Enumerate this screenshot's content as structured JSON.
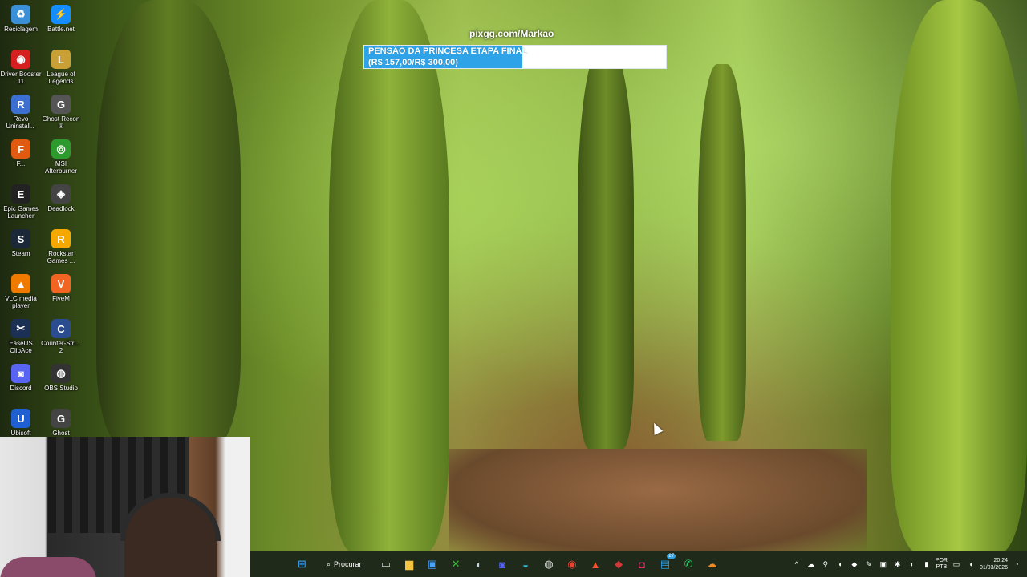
{
  "desktop": {
    "icons": [
      {
        "label": "Reciclagem",
        "icon": "recycle-bin-icon",
        "color": "#3a8fd6",
        "glyph": "♻"
      },
      {
        "label": "Battle.net",
        "icon": "battlenet-icon",
        "color": "#148eff",
        "glyph": "⚡"
      },
      {
        "label": "Driver Booster 11",
        "icon": "driver-booster-icon",
        "color": "#d62020",
        "glyph": "◉"
      },
      {
        "label": "League of Legends",
        "icon": "league-of-legends-icon",
        "color": "#c8a035",
        "glyph": "L"
      },
      {
        "label": "Revo Uninstall...",
        "icon": "revo-uninstaller-icon",
        "color": "#3b6fd0",
        "glyph": "R"
      },
      {
        "label": "Ghost Recon ®",
        "icon": "ghost-recon-icon",
        "color": "#555555",
        "glyph": "G"
      },
      {
        "label": "F...",
        "icon": "orange-app-icon",
        "color": "#e05a10",
        "glyph": "F"
      },
      {
        "label": "MSI Afterburner",
        "icon": "msi-afterburner-icon",
        "color": "#2c9a2c",
        "glyph": "◎"
      },
      {
        "label": "Epic Games Launcher",
        "icon": "epic-games-icon",
        "color": "#222222",
        "glyph": "E"
      },
      {
        "label": "Deadlock",
        "icon": "deadlock-icon",
        "color": "#444444",
        "glyph": "◈"
      },
      {
        "label": "Steam",
        "icon": "steam-icon",
        "color": "#1b2838",
        "glyph": "S"
      },
      {
        "label": "Rockstar Games ...",
        "icon": "rockstar-icon",
        "color": "#f5a800",
        "glyph": "R"
      },
      {
        "label": "VLC media player",
        "icon": "vlc-icon",
        "color": "#f07a00",
        "glyph": "▲"
      },
      {
        "label": "FiveM",
        "icon": "fivem-icon",
        "color": "#f26422",
        "glyph": "V"
      },
      {
        "label": "EaseUS ClipAce",
        "icon": "easeus-clipace-icon",
        "color": "#1c2f55",
        "glyph": "✂"
      },
      {
        "label": "Counter-Stri... 2",
        "icon": "counter-strike-icon",
        "color": "#2b4c8f",
        "glyph": "C"
      },
      {
        "label": "Discord",
        "icon": "discord-icon",
        "color": "#5865f2",
        "glyph": "◙"
      },
      {
        "label": "OBS Studio",
        "icon": "obs-studio-icon",
        "color": "#333333",
        "glyph": "◍"
      },
      {
        "label": "Ubisoft",
        "icon": "ubisoft-icon",
        "color": "#1f5fd1",
        "glyph": "U"
      },
      {
        "label": "Ghost",
        "icon": "ghost-icon",
        "color": "#444444",
        "glyph": "G"
      }
    ]
  },
  "overlay": {
    "watermark": "pixgg.com/Markao",
    "goal_title": "PENSÃO DA PRINCESA ETAPA FINAL",
    "goal_amount": "(R$ 157,00/R$ 300,00)",
    "goal_progress_fraction": 0.523,
    "fill_color": "#2ea3e8"
  },
  "taskbar": {
    "search_label": "Procurar",
    "apps": [
      {
        "name": "start-button",
        "glyph": "⊞",
        "color": "#3fa9ff"
      },
      {
        "name": "search-pill",
        "glyph": "",
        "color": ""
      },
      {
        "name": "task-view-button",
        "glyph": "▭",
        "color": "#cccccc"
      },
      {
        "name": "file-explorer-button",
        "glyph": "▆",
        "color": "#f5c542"
      },
      {
        "name": "store-button",
        "glyph": "▣",
        "color": "#4aa3ff"
      },
      {
        "name": "xbox-button",
        "glyph": "✕",
        "color": "#3dbb3d"
      },
      {
        "name": "steam-button",
        "glyph": "◐",
        "color": "#c7d5e0"
      },
      {
        "name": "discord-button",
        "glyph": "◙",
        "color": "#5865f2"
      },
      {
        "name": "edge-button",
        "glyph": "◒",
        "color": "#2fb6d6"
      },
      {
        "name": "obs-button",
        "glyph": "◍",
        "color": "#dddddd"
      },
      {
        "name": "chrome-button",
        "glyph": "◉",
        "color": "#ea4335"
      },
      {
        "name": "brave-button",
        "glyph": "▲",
        "color": "#fb542b"
      },
      {
        "name": "riot-button",
        "glyph": "◆",
        "color": "#d13639"
      },
      {
        "name": "instagram-button",
        "glyph": "◘",
        "color": "#e1306c"
      },
      {
        "name": "messages-button",
        "glyph": "▤",
        "color": "#2aa1f0",
        "badge": "27"
      },
      {
        "name": "whatsapp-button",
        "glyph": "✆",
        "color": "#25d366"
      },
      {
        "name": "cloud-app-button",
        "glyph": "☁",
        "color": "#f08a24"
      }
    ],
    "tray": {
      "chevron": "^",
      "language_top": "POR",
      "language_bottom": "PTB",
      "time": "20:24",
      "date": "01/03/2026"
    }
  }
}
